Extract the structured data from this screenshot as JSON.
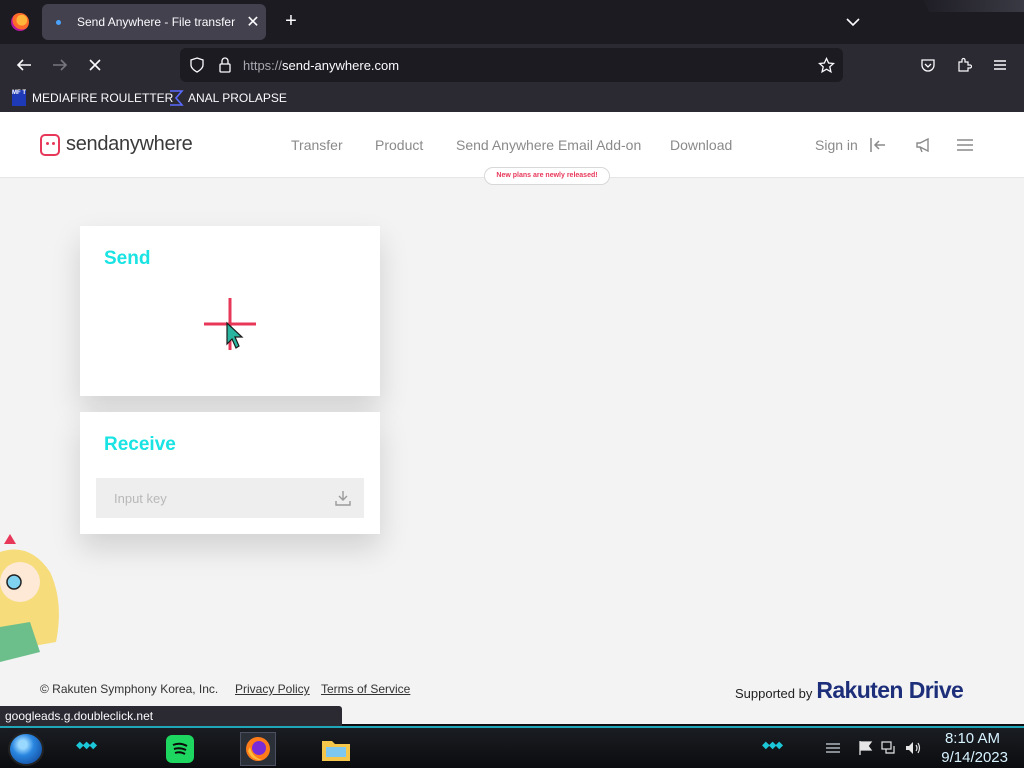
{
  "browser": {
    "tab": {
      "title": "Send Anywhere - File transfer",
      "close": "✕"
    },
    "new_tab": "+",
    "url": {
      "protocol": "https://",
      "host": "send-anywhere.com"
    },
    "bookmarks": [
      {
        "label": "MEDIAFIRE ROULETTER",
        "icon_text": "MF T"
      },
      {
        "label": "ANAL PROLAPSE"
      }
    ],
    "status_url": "googleads.g.doubleclick.net"
  },
  "site": {
    "brand": "sendanywhere",
    "nav": [
      "Transfer",
      "Product",
      "Send Anywhere Email Add-on",
      "Download"
    ],
    "promo": "New plans are newly released!",
    "sign_in": "Sign in",
    "send": {
      "title": "Send"
    },
    "receive": {
      "title": "Receive",
      "placeholder": "Input key"
    },
    "footer": {
      "copyright": "© Rakuten Symphony Korea, Inc.",
      "privacy": "Privacy Policy",
      "terms": "Terms of Service",
      "supported_by": "Supported by",
      "sponsor": "Rakuten",
      "sponsor_suffix": "Drive"
    }
  },
  "taskbar": {
    "time": "8:10 AM",
    "date": "9/14/2023",
    "apps": [
      "spotify-icon",
      "firefox-icon",
      "file-explorer-icon"
    ]
  },
  "colors": {
    "accent_cyan": "#19e3e3",
    "brand_pink": "#e8385a",
    "rakuten_navy": "#1d2f7a"
  }
}
